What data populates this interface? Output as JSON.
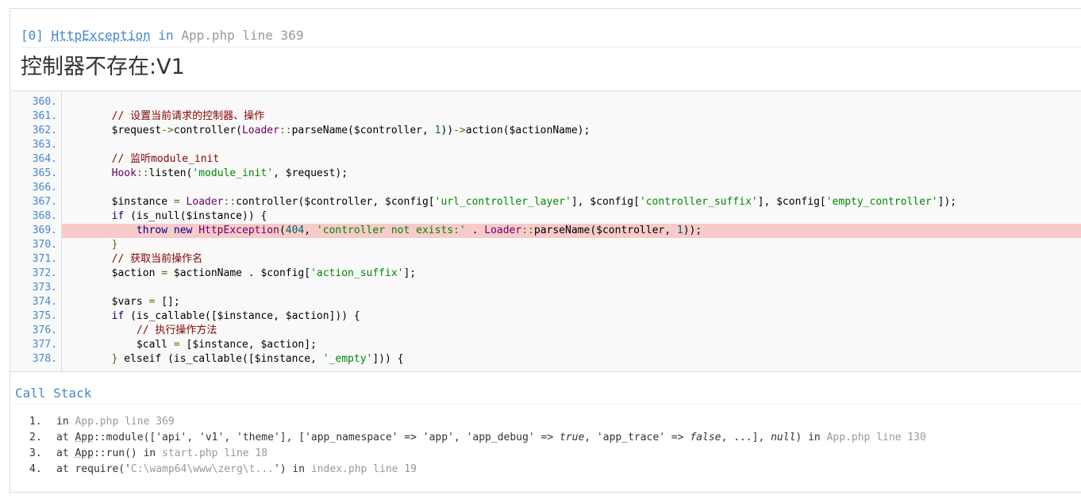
{
  "header": {
    "trace_id": "[0]",
    "exception_class": "HttpException",
    "in_word": "in",
    "file_location": "App.php line 369",
    "message": "控制器不存在:V1"
  },
  "source": {
    "highlight_line": "369.",
    "lines": [
      {
        "ln": "360.",
        "parts": []
      },
      {
        "ln": "361.",
        "parts": [
          [
            "pln",
            "        "
          ],
          [
            "com",
            "// 设置当前请求的控制器、操作"
          ]
        ]
      },
      {
        "ln": "362.",
        "parts": [
          [
            "pln",
            "        $request"
          ],
          [
            "pun",
            "->"
          ],
          [
            "pln",
            "controller("
          ],
          [
            "typ",
            "Loader"
          ],
          [
            "pun",
            "::"
          ],
          [
            "pln",
            "parseName($controller, "
          ],
          [
            "num",
            "1"
          ],
          [
            "pln",
            "))"
          ],
          [
            "pun",
            "->"
          ],
          [
            "pln",
            "action($actionName);"
          ]
        ]
      },
      {
        "ln": "363.",
        "parts": []
      },
      {
        "ln": "364.",
        "parts": [
          [
            "pln",
            "        "
          ],
          [
            "com",
            "// 监听module_init"
          ]
        ]
      },
      {
        "ln": "365.",
        "parts": [
          [
            "pln",
            "        "
          ],
          [
            "typ",
            "Hook"
          ],
          [
            "pun",
            "::"
          ],
          [
            "pln",
            "listen("
          ],
          [
            "str",
            "'module_init'"
          ],
          [
            "pln",
            ", $request);"
          ]
        ]
      },
      {
        "ln": "366.",
        "parts": []
      },
      {
        "ln": "367.",
        "parts": [
          [
            "pln",
            "        $instance "
          ],
          [
            "pun",
            "="
          ],
          [
            "pln",
            " "
          ],
          [
            "typ",
            "Loader"
          ],
          [
            "pun",
            "::"
          ],
          [
            "pln",
            "controller($controller, $config["
          ],
          [
            "str",
            "'url_controller_layer'"
          ],
          [
            "pln",
            "], $config["
          ],
          [
            "str",
            "'controller_suffix'"
          ],
          [
            "pln",
            "], $config["
          ],
          [
            "str",
            "'empty_controller'"
          ],
          [
            "pln",
            "]);"
          ]
        ]
      },
      {
        "ln": "368.",
        "parts": [
          [
            "pln",
            "        "
          ],
          [
            "kw",
            "if"
          ],
          [
            "pln",
            " (is_null($instance)) {"
          ]
        ]
      },
      {
        "ln": "369.",
        "parts": [
          [
            "pln",
            "            "
          ],
          [
            "kw",
            "throw"
          ],
          [
            "pln",
            " "
          ],
          [
            "kw",
            "new"
          ],
          [
            "pln",
            " "
          ],
          [
            "typ",
            "HttpException"
          ],
          [
            "pln",
            "("
          ],
          [
            "num",
            "404"
          ],
          [
            "pln",
            ", "
          ],
          [
            "str",
            "'controller not exists:'"
          ],
          [
            "pln",
            " . "
          ],
          [
            "typ",
            "Loader"
          ],
          [
            "pun",
            "::"
          ],
          [
            "pln",
            "parseName($controller, "
          ],
          [
            "num",
            "1"
          ],
          [
            "pln",
            "));"
          ]
        ]
      },
      {
        "ln": "370.",
        "parts": [
          [
            "pln",
            "        "
          ],
          [
            "pun",
            "}"
          ]
        ]
      },
      {
        "ln": "371.",
        "parts": [
          [
            "pln",
            "        "
          ],
          [
            "com",
            "// 获取当前操作名"
          ]
        ]
      },
      {
        "ln": "372.",
        "parts": [
          [
            "pln",
            "        $action "
          ],
          [
            "pun",
            "="
          ],
          [
            "pln",
            " $actionName . $config["
          ],
          [
            "str",
            "'action_suffix'"
          ],
          [
            "pln",
            "];"
          ]
        ]
      },
      {
        "ln": "373.",
        "parts": []
      },
      {
        "ln": "374.",
        "parts": [
          [
            "pln",
            "        $vars "
          ],
          [
            "pun",
            "="
          ],
          [
            "pln",
            " [];"
          ]
        ]
      },
      {
        "ln": "375.",
        "parts": [
          [
            "pln",
            "        "
          ],
          [
            "kw",
            "if"
          ],
          [
            "pln",
            " (is_callable([$instance, $action])) {"
          ]
        ]
      },
      {
        "ln": "376.",
        "parts": [
          [
            "pln",
            "            "
          ],
          [
            "com",
            "// 执行操作方法"
          ]
        ]
      },
      {
        "ln": "377.",
        "parts": [
          [
            "pln",
            "            $call "
          ],
          [
            "pun",
            "="
          ],
          [
            "pln",
            " [$instance, $action];"
          ]
        ]
      },
      {
        "ln": "378.",
        "parts": [
          [
            "pln",
            "        "
          ],
          [
            "pun",
            "}"
          ],
          [
            "pln",
            " elseif (is_callable([$instance, "
          ],
          [
            "str",
            "'_empty'"
          ],
          [
            "pln",
            "])) {"
          ]
        ]
      }
    ]
  },
  "trace": {
    "title": "Call Stack",
    "items": [
      {
        "num": "1.",
        "parts": [
          [
            "t",
            "in "
          ],
          [
            "g",
            "App.php line 369"
          ]
        ]
      },
      {
        "num": "2.",
        "parts": [
          [
            "t",
            "at "
          ],
          [
            "a",
            "App"
          ],
          [
            "t",
            "::module(['api', 'v1', 'theme'], ['app_namespace' => 'app', 'app_debug' => "
          ],
          [
            "e",
            "true"
          ],
          [
            "t",
            ", 'app_trace' => "
          ],
          [
            "e",
            "false"
          ],
          [
            "t",
            ", ...], "
          ],
          [
            "e",
            "null"
          ],
          [
            "t",
            ") in "
          ],
          [
            "g",
            "App.php line 130"
          ]
        ]
      },
      {
        "num": "3.",
        "parts": [
          [
            "t",
            "at "
          ],
          [
            "a",
            "App"
          ],
          [
            "t",
            "::run() in "
          ],
          [
            "g",
            "start.php line 18"
          ]
        ]
      },
      {
        "num": "4.",
        "parts": [
          [
            "t",
            "at require('"
          ],
          [
            "g",
            "C:\\wamp64\\www\\zerg\\t..."
          ],
          [
            "t",
            "') in "
          ],
          [
            "g",
            "index.php line 19"
          ]
        ]
      }
    ]
  }
}
